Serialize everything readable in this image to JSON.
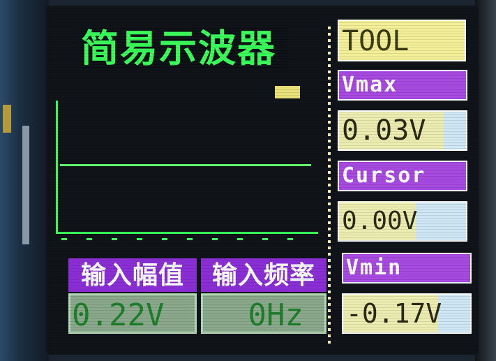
{
  "title": "简易示波器",
  "graph": {
    "trace_level": 0.5
  },
  "bottom": {
    "amp_label": "输入幅值",
    "freq_label": "输入频率",
    "amp_value": "0.22V",
    "freq_value": "0Hz"
  },
  "tool": {
    "title": "TOOL",
    "vmax_label": "Vmax",
    "vmax_value": "0.03V",
    "cursor_label": "Cursor",
    "cursor_value": "0.00V",
    "vmin_label": "Vmin",
    "vmin_value": "-0.17V"
  },
  "colors": {
    "trace": "#66ff70",
    "label_purple": "#8a2fd6",
    "tool_yellow": "#f2ef98"
  },
  "icons": [
    "cursor-marker"
  ]
}
